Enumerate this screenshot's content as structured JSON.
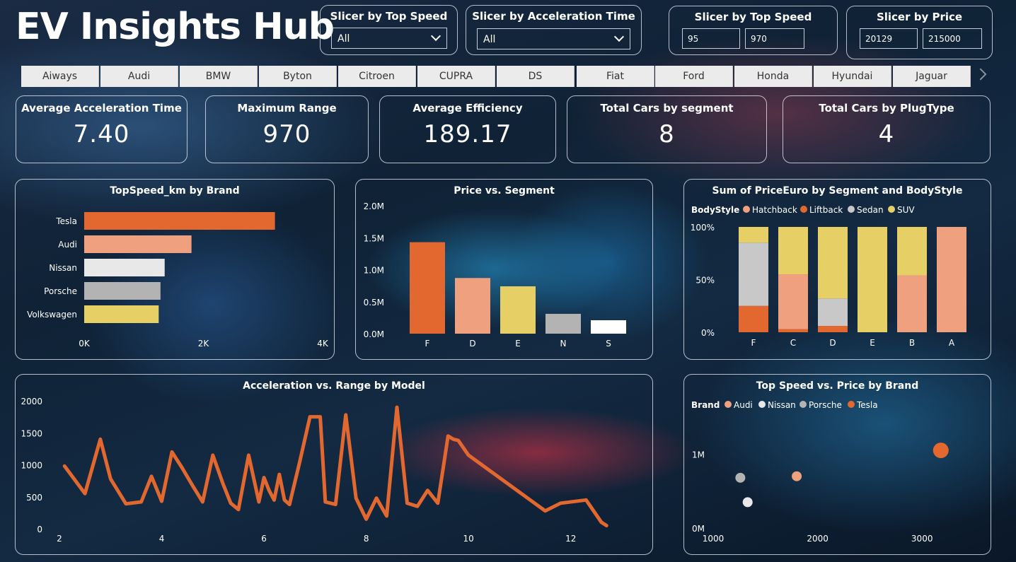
{
  "title": "EV Insights Hub",
  "slicers": {
    "top_speed_dropdown": {
      "title": "Slicer by Top Speed",
      "value": "All"
    },
    "accel_dropdown": {
      "title": "Slicer by Acceleration Time",
      "value": "All"
    },
    "top_speed_range": {
      "title": "Slicer by Top Speed",
      "min": "95",
      "max": "970"
    },
    "price_range": {
      "title": "Slicer by Price",
      "min": "20129",
      "max": "215000"
    }
  },
  "brands": [
    "Aiways",
    "Audi",
    "BMW",
    "Byton",
    "Citroen",
    "CUPRA",
    "DS",
    "Fiat",
    "Ford",
    "Honda",
    "Hyundai",
    "Jaguar"
  ],
  "kpis": [
    {
      "label": "Average Acceleration Time",
      "value": "7.40"
    },
    {
      "label": "Maximum Range",
      "value": "970"
    },
    {
      "label": "Average Efficiency",
      "value": "189.17"
    },
    {
      "label": "Total Cars by segment",
      "value": "8"
    },
    {
      "label": "Total Cars by PlugType",
      "value": "4"
    }
  ],
  "colors": {
    "orange": "#e3682f",
    "salmon": "#efa07e",
    "light_gray": "#e8e8e8",
    "gray": "#b3b3b3",
    "yellow": "#e6cf64",
    "white": "#ffffff"
  },
  "chart_data": [
    {
      "type": "bar",
      "orientation": "horizontal",
      "title": "TopSpeed_km by Brand",
      "categories": [
        "Tesla",
        "Audi",
        "Nissan",
        "Porsche",
        "Volkswagen"
      ],
      "values": [
        3200,
        1800,
        1350,
        1280,
        1250
      ],
      "colors": [
        "#e3682f",
        "#efa07e",
        "#e8e8e8",
        "#b3b3b3",
        "#e6cf64"
      ],
      "xlim": [
        0,
        4000
      ],
      "xticks": [
        "0K",
        "2K",
        "4K"
      ]
    },
    {
      "type": "bar",
      "title": "Price vs. Segment",
      "categories": [
        "F",
        "D",
        "E",
        "N",
        "S"
      ],
      "values": [
        1430000,
        870000,
        740000,
        310000,
        210000
      ],
      "colors": [
        "#e3682f",
        "#efa07e",
        "#e6cf64",
        "#b3b3b3",
        "#ffffff"
      ],
      "ylim": [
        0,
        2000000
      ],
      "yticks": [
        "0.0M",
        "0.5M",
        "1.0M",
        "1.5M",
        "2.0M"
      ]
    },
    {
      "type": "bar",
      "stacked": "100%",
      "title": "Sum of PriceEuro by Segment and BodyStyle",
      "legend_title": "BodyStyle",
      "categories": [
        "F",
        "C",
        "D",
        "E",
        "B",
        "A"
      ],
      "series": [
        {
          "name": "Hatchback",
          "color": "#efa07e",
          "values": [
            0,
            0.52,
            0,
            0,
            0.54,
            1.0
          ]
        },
        {
          "name": "Liftback",
          "color": "#e3682f",
          "values": [
            0.25,
            0.03,
            0.06,
            0,
            0,
            0
          ]
        },
        {
          "name": "Sedan",
          "color": "#c8c8c8",
          "values": [
            0.6,
            0,
            0.26,
            0,
            0,
            0
          ]
        },
        {
          "name": "SUV",
          "color": "#e6cf64",
          "values": [
            0.15,
            0.45,
            0.68,
            1.0,
            0.46,
            0
          ]
        }
      ],
      "yticks": [
        "0%",
        "50%",
        "100%"
      ]
    },
    {
      "type": "line",
      "title": "Acceleration vs. Range by Model",
      "color": "#e3682f",
      "xlim": [
        2,
        13
      ],
      "ylim": [
        0,
        2000
      ],
      "xticks": [
        2,
        4,
        6,
        8,
        10,
        12
      ],
      "yticks": [
        0,
        500,
        1000,
        1500,
        2000
      ],
      "x": [
        2.1,
        2.5,
        2.8,
        3.0,
        3.3,
        3.6,
        3.8,
        4.0,
        4.2,
        4.4,
        4.6,
        4.8,
        5.0,
        5.2,
        5.35,
        5.5,
        5.7,
        5.9,
        6.0,
        6.1,
        6.2,
        6.3,
        6.4,
        6.5,
        6.7,
        6.9,
        7.1,
        7.2,
        7.4,
        7.6,
        7.8,
        8.0,
        8.2,
        8.4,
        8.6,
        8.8,
        9.0,
        9.2,
        9.4,
        9.6,
        9.7,
        9.8,
        10.0,
        11.5,
        11.8,
        12.3,
        12.6,
        12.7
      ],
      "y": [
        980,
        550,
        1400,
        780,
        390,
        420,
        820,
        430,
        1200,
        950,
        680,
        420,
        1150,
        700,
        400,
        300,
        1150,
        420,
        800,
        600,
        450,
        850,
        450,
        380,
        1050,
        1750,
        1750,
        420,
        380,
        1780,
        480,
        150,
        480,
        200,
        1900,
        400,
        350,
        600,
        400,
        1450,
        1400,
        1380,
        1150,
        280,
        400,
        450,
        100,
        50
      ]
    },
    {
      "type": "scatter",
      "title": "Top Speed vs. Price by Brand",
      "legend_title": "Brand",
      "xlim": [
        1000,
        3500
      ],
      "ylim": [
        0,
        1500000
      ],
      "xticks": [
        1000,
        2000,
        3000
      ],
      "yticks": [
        "0M",
        "1M"
      ],
      "series": [
        {
          "name": "Audi",
          "color": "#efa07e",
          "points": [
            [
              1800,
              700000
            ]
          ]
        },
        {
          "name": "Nissan",
          "color": "#e8e8e8",
          "points": [
            [
              1330,
              350000
            ]
          ]
        },
        {
          "name": "Porsche",
          "color": "#b3b3b3",
          "points": [
            [
              1260,
              680000
            ]
          ]
        },
        {
          "name": "Tesla",
          "color": "#e3682f",
          "points": [
            [
              3180,
              1050000
            ]
          ]
        }
      ]
    }
  ]
}
